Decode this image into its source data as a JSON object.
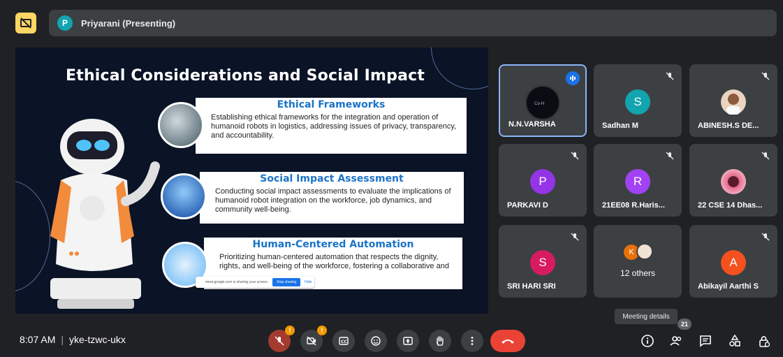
{
  "presenter": {
    "initial": "P",
    "label": "Priyarani (Presenting)"
  },
  "slide": {
    "title": "Ethical Considerations and Social Impact",
    "cards": [
      {
        "title": "Ethical Frameworks",
        "body": "Establishing ethical frameworks for the integration and operation of humanoid robots in logistics, addressing issues of privacy, transparency, and accountability."
      },
      {
        "title": "Social Impact Assessment",
        "body": "Conducting social impact assessments to evaluate the implications of humanoid robot integration on the workforce, job dynamics, and community well-being."
      },
      {
        "title": "Human-Centered Automation",
        "body": "Prioritizing human-centered automation that respects the dignity, rights, and well-being of the workforce, fostering a collaborative and"
      }
    ],
    "share_banner": {
      "text": "meet.google.com is sharing your screen.",
      "stop": "Stop sharing",
      "hide": "Hide"
    }
  },
  "participants": [
    {
      "name": "N.N.VARSHA",
      "initial": "",
      "color": "#0b0b14",
      "active": true
    },
    {
      "name": "Sadhan M",
      "initial": "S",
      "color": "#12a4af"
    },
    {
      "name": "ABINESH.S DE...",
      "initial": "",
      "color": "#e9d4c2"
    },
    {
      "name": "PARKAVI D",
      "initial": "P",
      "color": "#9334e6"
    },
    {
      "name": "21EE08 R.Haris...",
      "initial": "R",
      "color": "#a142f4"
    },
    {
      "name": "22 CSE 14 Dhas...",
      "initial": "",
      "color": "#e46a8c"
    },
    {
      "name": "SRI HARI SRI",
      "initial": "S",
      "color": "#d81b60"
    },
    {
      "name": "12 others",
      "initial": "K",
      "color": "#e8710a"
    },
    {
      "name": "Abikayil Aarthi S",
      "initial": "A",
      "color": "#f4511e"
    }
  ],
  "bottom": {
    "time": "8:07 AM",
    "meeting_code": "yke-tzwc-ukx",
    "warning_badge": "!",
    "tooltip": "Meeting details",
    "people_count": "21"
  },
  "icons": [
    "present-off-icon",
    "mic-off-icon",
    "camera-off-icon",
    "captions-icon",
    "emoji-icon",
    "present-screen-icon",
    "raise-hand-icon",
    "more-options-icon",
    "end-call-icon",
    "info-icon",
    "people-icon",
    "chat-icon",
    "activities-icon",
    "host-controls-icon"
  ],
  "colors": {
    "background": "#202124",
    "tile": "#3c4043",
    "accent": "#8ab4f8",
    "end_call": "#ea4335",
    "warning": "#f29900"
  }
}
